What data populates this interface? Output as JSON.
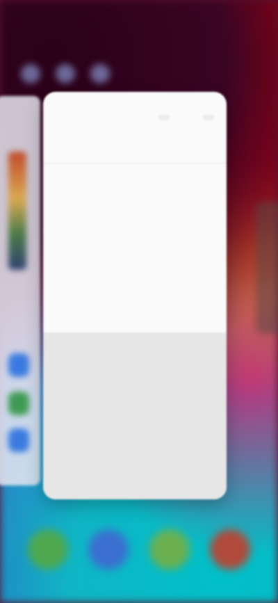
{
  "screen": {
    "view": "recent-apps"
  },
  "app_card": {
    "topbar_actions": [
      "",
      ""
    ],
    "tabs": [
      "",
      ""
    ],
    "rows": [
      {
        "label": "",
        "value": ""
      },
      {
        "label": "",
        "value": ""
      },
      {
        "label": "",
        "value": ""
      },
      {
        "label": "",
        "value": ""
      },
      {
        "label": "",
        "value": ""
      },
      {
        "label": "",
        "value": ""
      },
      {
        "label": "",
        "value": ""
      },
      {
        "label": "",
        "value": ""
      }
    ]
  },
  "colors": {
    "wallpaper_top": "#2b0018",
    "wallpaper_red": "#d00000",
    "wallpaper_bottom": "#10b5c5",
    "card": "#fafafa",
    "card_gray": "#e6e6e6",
    "accent": "#d05050"
  },
  "dock": {
    "icons": [
      {
        "name": "phone-icon",
        "color": "#4fa84f"
      },
      {
        "name": "messages-icon",
        "color": "#3b6fd0"
      },
      {
        "name": "browser-icon",
        "color": "#6bb050"
      },
      {
        "name": "camera-icon",
        "color": "#b04a3a"
      }
    ]
  },
  "left_card": {
    "icons": [
      {
        "name": "app-icon-blue",
        "color": "#3a7ae0"
      },
      {
        "name": "app-icon-green",
        "color": "#3f9a55"
      },
      {
        "name": "app-icon-blue-2",
        "color": "#3a7ae0"
      }
    ]
  }
}
